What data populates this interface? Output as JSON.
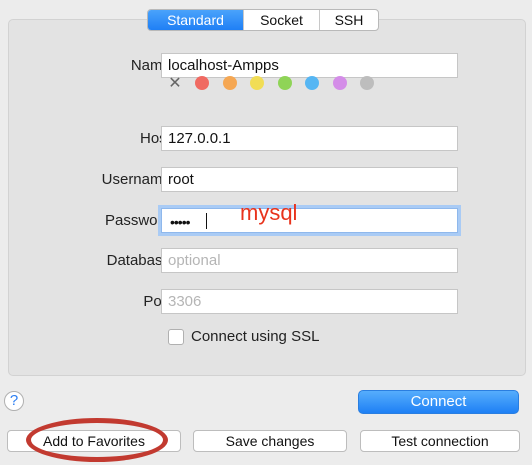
{
  "tabs": [
    {
      "label": "Standard",
      "active": true
    },
    {
      "label": "Socket",
      "active": false
    },
    {
      "label": "SSH",
      "active": false
    }
  ],
  "form": {
    "name_label": "Name:",
    "name_value": "localhost-Ampps",
    "host_label": "Host:",
    "host_value": "127.0.0.1",
    "username_label": "Username:",
    "username_value": "root",
    "password_label": "Password:",
    "password_masked": "•••••",
    "password_annotation": "mysql",
    "database_label": "Database:",
    "database_placeholder": "optional",
    "port_label": "Port:",
    "port_placeholder": "3306",
    "ssl_label": "Connect using SSL"
  },
  "colors": [
    "#f06a62",
    "#f5a753",
    "#f1dd55",
    "#8fd457",
    "#56b6f3",
    "#d48de8",
    "#bdbdbd"
  ],
  "icons": {
    "clear_color": "x-mark-icon",
    "help": "question-mark-icon"
  },
  "help_label": "?",
  "buttons": {
    "connect": "Connect",
    "add_favorites": "Add to Favorites",
    "save_changes": "Save changes",
    "test_connection": "Test connection"
  }
}
